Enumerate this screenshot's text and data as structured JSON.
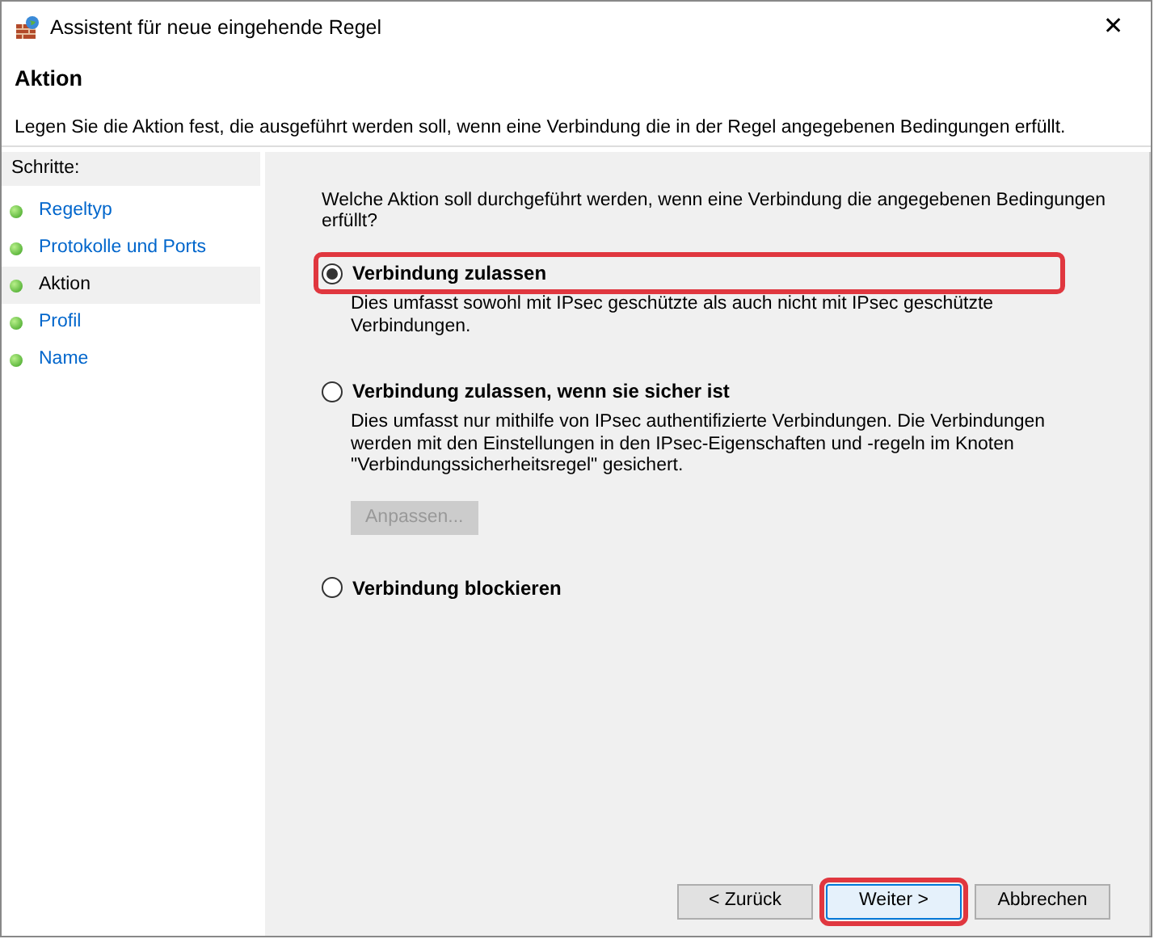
{
  "window": {
    "title": "Assistent für neue eingehende Regel",
    "close": "✕"
  },
  "header": {
    "title": "Aktion",
    "description": "Legen Sie die Aktion fest, die ausgeführt werden soll, wenn eine Verbindung die in der Regel angegebenen Bedingungen erfüllt."
  },
  "steps": {
    "heading": "Schritte:",
    "items": [
      {
        "label": "Regeltyp",
        "selected": false
      },
      {
        "label": "Protokolle und Ports",
        "selected": false
      },
      {
        "label": "Aktion",
        "selected": true
      },
      {
        "label": "Profil",
        "selected": false
      },
      {
        "label": "Name",
        "selected": false
      }
    ]
  },
  "question": "Welche Aktion soll durchgeführt werden, wenn eine Verbindung die angegebenen Bedingungen erfüllt?",
  "options": [
    {
      "label": "Verbindung zulassen",
      "selected": true,
      "highlighted": true,
      "description": "Dies umfasst sowohl mit IPsec geschützte als auch nicht mit IPsec geschützte Verbindungen."
    },
    {
      "label": "Verbindung zulassen, wenn sie sicher ist",
      "selected": false,
      "highlighted": false,
      "description": "Dies umfasst nur mithilfe von IPsec authentifizierte Verbindungen. Die Verbindungen werden mit den Einstellungen in den IPsec-Eigenschaften und -regeln im Knoten \"Verbindungssicherheitsregel\" gesichert.",
      "button": {
        "label": "Anpassen...",
        "disabled": true
      }
    },
    {
      "label": "Verbindung blockieren",
      "selected": false,
      "highlighted": false
    }
  ],
  "buttons": [
    {
      "label": "< Zurück",
      "highlighted": false
    },
    {
      "label": "Weiter >",
      "highlighted": true
    },
    {
      "label": "Abbrechen",
      "highlighted": false
    }
  ]
}
